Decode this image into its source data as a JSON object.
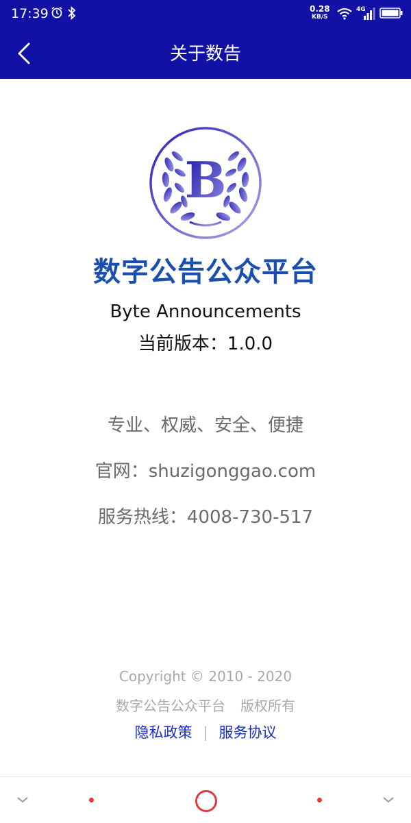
{
  "status_bar": {
    "time": "17:39",
    "net_speed_value": "0.28",
    "net_speed_unit": "KB/S",
    "network_type": "4G"
  },
  "header": {
    "title": "关于数告",
    "back_icon": "chevron-left-icon"
  },
  "app": {
    "logo_letter": "B",
    "name_cn": "数字公告公众平台",
    "name_en": "Byte Announcements",
    "version_text": "当前版本：1.0.0"
  },
  "info": {
    "slogan": "专业、权威、安全、便捷",
    "website": "官网：shuzigonggao.com",
    "hotline": "服务热线：4008-730-517"
  },
  "footer": {
    "copyright": "Copyright © 2010 - 2020",
    "owner": "数字公告公众平台",
    "rights": "版权所有",
    "privacy_link": "隐私政策",
    "separator": "|",
    "service_link": "服务协议"
  },
  "colors": {
    "header_bg": "#1111a6",
    "brand_blue": "#1a4fb0",
    "link_blue": "#1a2fc8",
    "nav_accent": "#e03a3a"
  }
}
